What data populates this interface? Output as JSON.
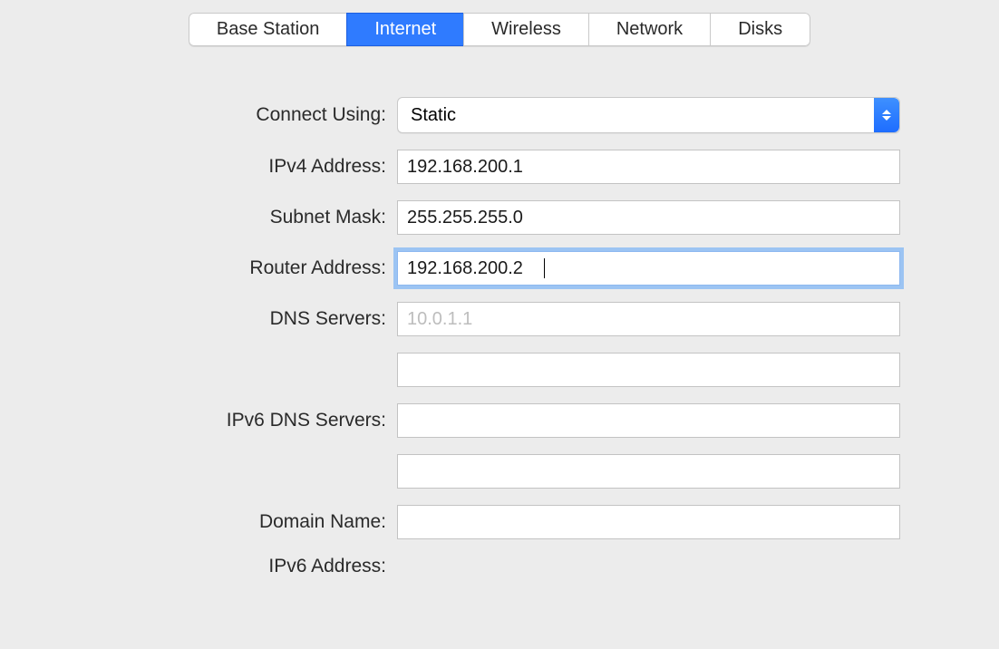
{
  "tabs": {
    "base_station": "Base Station",
    "internet": "Internet",
    "wireless": "Wireless",
    "network": "Network",
    "disks": "Disks"
  },
  "labels": {
    "connect_using": "Connect Using:",
    "ipv4_address": "IPv4 Address:",
    "subnet_mask": "Subnet Mask:",
    "router_address": "Router Address:",
    "dns_servers": "DNS Servers:",
    "ipv6_dns_servers": "IPv6 DNS Servers:",
    "domain_name": "Domain Name:",
    "ipv6_address": "IPv6 Address:"
  },
  "values": {
    "connect_using": "Static",
    "ipv4_address": "192.168.200.1",
    "subnet_mask": "255.255.255.0",
    "router_address": "192.168.200.2",
    "dns_servers_1": "",
    "dns_servers_2": "",
    "ipv6_dns_servers_1": "",
    "ipv6_dns_servers_2": "",
    "domain_name": ""
  },
  "placeholders": {
    "dns_servers_1": "10.0.1.1"
  }
}
